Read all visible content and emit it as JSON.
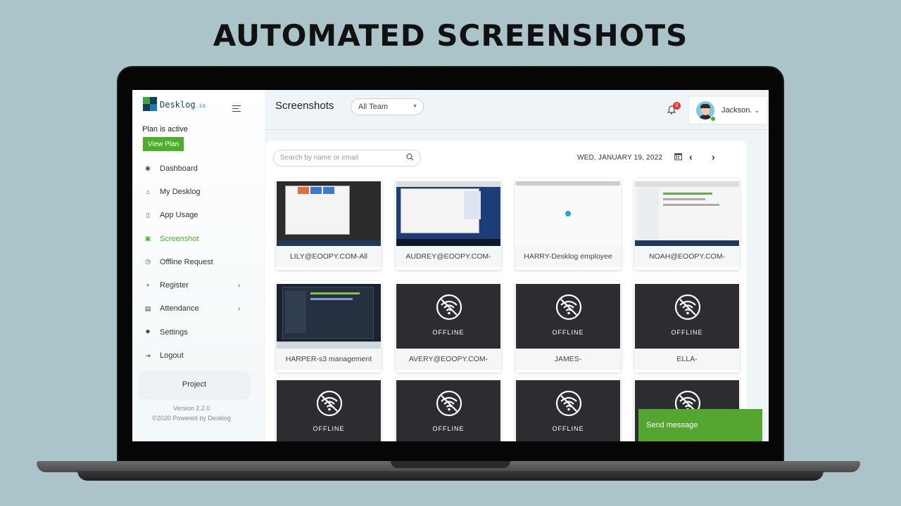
{
  "headline": "AUTOMATED SCREENSHOTS",
  "app": {
    "logo_text": "Desklog",
    "logo_suffix": ".io",
    "brand_color": "#4caf2a"
  },
  "sidebar": {
    "plan_status": "Plan is active",
    "view_plan_label": "View Plan",
    "items": [
      {
        "label": "Dashboard",
        "icon": "dashboard-icon"
      },
      {
        "label": "My Desklog",
        "icon": "home-icon"
      },
      {
        "label": "App Usage",
        "icon": "mobile-icon"
      },
      {
        "label": "Screenshot",
        "icon": "image-icon",
        "active": true
      },
      {
        "label": "Offline Request",
        "icon": "clock-icon"
      },
      {
        "label": "Register",
        "icon": "plus-icon",
        "chevron": "›"
      },
      {
        "label": "Attendance",
        "icon": "list-icon",
        "chevron": "›"
      },
      {
        "label": "Settings",
        "icon": "gear-icon"
      },
      {
        "label": "Logout",
        "icon": "logout-icon"
      }
    ],
    "project_label": "Project",
    "version": "Version 2.2.0",
    "powered_by": "©2020 Powered by Desklog"
  },
  "header": {
    "title": "Screenshots",
    "team_select": "All Team",
    "notification_count": "0",
    "user_name": "Jackson.",
    "user_caret": "⌄"
  },
  "toolbar": {
    "search_placeholder": "Search by name or email",
    "date": "WED, JANUARY 19, 2022",
    "prev": "‹",
    "next": "›"
  },
  "screenshots": [
    {
      "caption": "LILY@EOOPY.COM-All",
      "status": "online"
    },
    {
      "caption": "AUDREY@EOOPY.COM-",
      "status": "online"
    },
    {
      "caption": "HARRY-Desklog employee",
      "status": "online"
    },
    {
      "caption": "NOAH@EOOPY.COM-",
      "status": "online"
    },
    {
      "caption": "HARPER-s3 management",
      "status": "online"
    },
    {
      "caption": "AVERY@EOOPY.COM-",
      "status": "offline"
    },
    {
      "caption": "JAMES-",
      "status": "offline"
    },
    {
      "caption": "ELLA-",
      "status": "offline"
    },
    {
      "caption": "",
      "status": "offline"
    },
    {
      "caption": "",
      "status": "offline"
    },
    {
      "caption": "",
      "status": "offline"
    },
    {
      "caption": "",
      "status": "offline"
    }
  ],
  "offline_label": "OFFLINE",
  "chat": {
    "send_label": "Send message"
  }
}
